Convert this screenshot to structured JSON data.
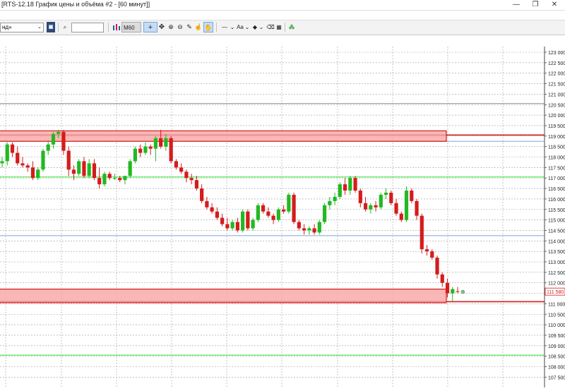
{
  "window": {
    "title": "[RTS-12.18 График цены и объёма #2 - [60 минут]]",
    "buttons": {
      "minimize": "—",
      "restore": "❐",
      "close": "✕"
    }
  },
  "toolbar": {
    "instrument_value": "нд»",
    "search_value": "",
    "timeframe": "M60",
    "font_label": "Aa"
  },
  "chart": {
    "axis_labels": [
      "123 000",
      "122 500",
      "122 000",
      "121 500",
      "121 000",
      "120 500",
      "120 000",
      "119 500",
      "119 000",
      "118 500",
      "118 000",
      "117 500",
      "117 000",
      "116 500",
      "116 000",
      "115 500",
      "115 000",
      "114 500",
      "114 000",
      "113 500",
      "113 000",
      "112 500",
      "112 000",
      "111 500",
      "111 000",
      "110 500",
      "110 000",
      "109 500",
      "109 000",
      "108 500",
      "108 000",
      "107 500"
    ],
    "last_price_label": "111 580",
    "colors": {
      "up": "#22b922",
      "down": "#d41c1c",
      "zone_fill": "#f7a5a5",
      "zone_border": "#d41c1c",
      "green_line": "#33e033",
      "blue_line": "#7ca4dc",
      "grid": "#9e9e9e",
      "axis_text": "#222222"
    }
  },
  "chart_data": {
    "type": "candlestick",
    "y_unit": "price points",
    "y_range": [
      107250,
      123250
    ],
    "candles": [
      {
        "o": 117700,
        "h": 118000,
        "l": 117500,
        "c": 117800
      },
      {
        "o": 117800,
        "h": 118700,
        "l": 117600,
        "c": 118600
      },
      {
        "o": 118600,
        "h": 118700,
        "l": 118000,
        "c": 118200
      },
      {
        "o": 118200,
        "h": 118500,
        "l": 117600,
        "c": 117700
      },
      {
        "o": 117700,
        "h": 118000,
        "l": 117500,
        "c": 117600
      },
      {
        "o": 117600,
        "h": 117700,
        "l": 117300,
        "c": 117500
      },
      {
        "o": 117500,
        "h": 117800,
        "l": 116900,
        "c": 117000
      },
      {
        "o": 117000,
        "h": 117500,
        "l": 116900,
        "c": 117400
      },
      {
        "o": 117400,
        "h": 118400,
        "l": 117300,
        "c": 118300
      },
      {
        "o": 118300,
        "h": 118800,
        "l": 118100,
        "c": 118600
      },
      {
        "o": 118600,
        "h": 119200,
        "l": 118400,
        "c": 119100
      },
      {
        "o": 119100,
        "h": 119300,
        "l": 118900,
        "c": 119200
      },
      {
        "o": 119200,
        "h": 119300,
        "l": 118100,
        "c": 118300
      },
      {
        "o": 118300,
        "h": 118500,
        "l": 117100,
        "c": 117400
      },
      {
        "o": 117400,
        "h": 117600,
        "l": 116900,
        "c": 117200
      },
      {
        "o": 117200,
        "h": 117900,
        "l": 117100,
        "c": 117800
      },
      {
        "o": 117800,
        "h": 118000,
        "l": 117000,
        "c": 117100
      },
      {
        "o": 117100,
        "h": 117900,
        "l": 117000,
        "c": 117700
      },
      {
        "o": 117700,
        "h": 117900,
        "l": 116900,
        "c": 117000
      },
      {
        "o": 117000,
        "h": 117500,
        "l": 116500,
        "c": 116700
      },
      {
        "o": 116700,
        "h": 117300,
        "l": 116600,
        "c": 117200
      },
      {
        "o": 117200,
        "h": 117300,
        "l": 116900,
        "c": 117000
      },
      {
        "o": 117000,
        "h": 117200,
        "l": 116900,
        "c": 117000
      },
      {
        "o": 117000,
        "h": 117100,
        "l": 116800,
        "c": 116900
      },
      {
        "o": 116900,
        "h": 117100,
        "l": 116700,
        "c": 117100
      },
      {
        "o": 117100,
        "h": 117900,
        "l": 117000,
        "c": 117800
      },
      {
        "o": 117800,
        "h": 118500,
        "l": 117700,
        "c": 118400
      },
      {
        "o": 118400,
        "h": 118600,
        "l": 118000,
        "c": 118200
      },
      {
        "o": 118200,
        "h": 118700,
        "l": 118100,
        "c": 118500
      },
      {
        "o": 118500,
        "h": 118600,
        "l": 118100,
        "c": 118400
      },
      {
        "o": 118400,
        "h": 119000,
        "l": 117800,
        "c": 118900
      },
      {
        "o": 118900,
        "h": 119300,
        "l": 118400,
        "c": 118500
      },
      {
        "o": 118500,
        "h": 119100,
        "l": 118300,
        "c": 118900
      },
      {
        "o": 118900,
        "h": 119000,
        "l": 117700,
        "c": 117800
      },
      {
        "o": 117800,
        "h": 117900,
        "l": 117400,
        "c": 117500
      },
      {
        "o": 117500,
        "h": 117700,
        "l": 117200,
        "c": 117300
      },
      {
        "o": 117300,
        "h": 117400,
        "l": 116800,
        "c": 117000
      },
      {
        "o": 117000,
        "h": 117200,
        "l": 116700,
        "c": 116900
      },
      {
        "o": 116900,
        "h": 117100,
        "l": 116400,
        "c": 116500
      },
      {
        "o": 116500,
        "h": 116700,
        "l": 115800,
        "c": 115900
      },
      {
        "o": 115900,
        "h": 116100,
        "l": 115500,
        "c": 115600
      },
      {
        "o": 115600,
        "h": 115800,
        "l": 115300,
        "c": 115400
      },
      {
        "o": 115400,
        "h": 115600,
        "l": 115000,
        "c": 115100
      },
      {
        "o": 115100,
        "h": 115300,
        "l": 114700,
        "c": 114800
      },
      {
        "o": 114800,
        "h": 115100,
        "l": 114500,
        "c": 114600
      },
      {
        "o": 114600,
        "h": 115000,
        "l": 114500,
        "c": 114900
      },
      {
        "o": 114900,
        "h": 115100,
        "l": 114400,
        "c": 114500
      },
      {
        "o": 114500,
        "h": 115500,
        "l": 114400,
        "c": 115400
      },
      {
        "o": 115400,
        "h": 115500,
        "l": 114500,
        "c": 114600
      },
      {
        "o": 114600,
        "h": 115100,
        "l": 114500,
        "c": 115000
      },
      {
        "o": 115000,
        "h": 115800,
        "l": 114900,
        "c": 115700
      },
      {
        "o": 115700,
        "h": 115800,
        "l": 115300,
        "c": 115400
      },
      {
        "o": 115400,
        "h": 115600,
        "l": 115100,
        "c": 115200
      },
      {
        "o": 115200,
        "h": 115300,
        "l": 114800,
        "c": 115000
      },
      {
        "o": 115000,
        "h": 115600,
        "l": 114900,
        "c": 115500
      },
      {
        "o": 115500,
        "h": 115700,
        "l": 115300,
        "c": 115400
      },
      {
        "o": 115400,
        "h": 116300,
        "l": 115300,
        "c": 116200
      },
      {
        "o": 116200,
        "h": 116300,
        "l": 114800,
        "c": 114900
      },
      {
        "o": 114900,
        "h": 115000,
        "l": 114500,
        "c": 114600
      },
      {
        "o": 114600,
        "h": 114800,
        "l": 114300,
        "c": 114500
      },
      {
        "o": 114500,
        "h": 114700,
        "l": 114300,
        "c": 114600
      },
      {
        "o": 114600,
        "h": 114800,
        "l": 114300,
        "c": 114400
      },
      {
        "o": 114400,
        "h": 115000,
        "l": 114300,
        "c": 114900
      },
      {
        "o": 114900,
        "h": 115800,
        "l": 114800,
        "c": 115700
      },
      {
        "o": 115700,
        "h": 116100,
        "l": 115500,
        "c": 115900
      },
      {
        "o": 115900,
        "h": 116300,
        "l": 115700,
        "c": 116100
      },
      {
        "o": 116100,
        "h": 116800,
        "l": 116000,
        "c": 116700
      },
      {
        "o": 116700,
        "h": 117000,
        "l": 116200,
        "c": 116400
      },
      {
        "o": 116400,
        "h": 117100,
        "l": 116200,
        "c": 117000
      },
      {
        "o": 117000,
        "h": 117100,
        "l": 116300,
        "c": 116400
      },
      {
        "o": 116400,
        "h": 116500,
        "l": 115600,
        "c": 115800
      },
      {
        "o": 115800,
        "h": 116100,
        "l": 115400,
        "c": 115500
      },
      {
        "o": 115500,
        "h": 115800,
        "l": 115300,
        "c": 115700
      },
      {
        "o": 115700,
        "h": 115900,
        "l": 115400,
        "c": 115600
      },
      {
        "o": 115600,
        "h": 116300,
        "l": 115500,
        "c": 116200
      },
      {
        "o": 116200,
        "h": 116500,
        "l": 116000,
        "c": 116300
      },
      {
        "o": 116300,
        "h": 116400,
        "l": 115700,
        "c": 115800
      },
      {
        "o": 115800,
        "h": 116000,
        "l": 115200,
        "c": 115300
      },
      {
        "o": 115300,
        "h": 115400,
        "l": 114900,
        "c": 115000
      },
      {
        "o": 115000,
        "h": 116600,
        "l": 114900,
        "c": 116400
      },
      {
        "o": 116400,
        "h": 116500,
        "l": 115800,
        "c": 115900
      },
      {
        "o": 115900,
        "h": 116000,
        "l": 115000,
        "c": 115200
      },
      {
        "o": 115200,
        "h": 115300,
        "l": 113400,
        "c": 113600
      },
      {
        "o": 113600,
        "h": 113800,
        "l": 113300,
        "c": 113500
      },
      {
        "o": 113500,
        "h": 113600,
        "l": 113100,
        "c": 113200
      },
      {
        "o": 113200,
        "h": 113300,
        "l": 112200,
        "c": 112400
      },
      {
        "o": 112400,
        "h": 112500,
        "l": 111800,
        "c": 112000
      },
      {
        "o": 112000,
        "h": 112200,
        "l": 111300,
        "c": 111500
      },
      {
        "o": 111500,
        "h": 111800,
        "l": 111100,
        "c": 111700
      },
      {
        "o": 111600,
        "h": 111800,
        "l": 111500,
        "c": 111580
      }
    ],
    "zones": [
      {
        "top": 119250,
        "bottom": 118750
      },
      {
        "top": 111700,
        "bottom": 111050
      }
    ],
    "hlines": [
      {
        "y": 119050,
        "color": "red"
      },
      {
        "y": 118750,
        "color": "blue"
      },
      {
        "y": 111100,
        "color": "red"
      },
      {
        "y": 117050,
        "color": "green"
      },
      {
        "y": 108550,
        "color": "green"
      },
      {
        "y": 114250,
        "color": "blue"
      },
      {
        "y": 120550,
        "color": "gray"
      }
    ],
    "last_price": 111580
  }
}
